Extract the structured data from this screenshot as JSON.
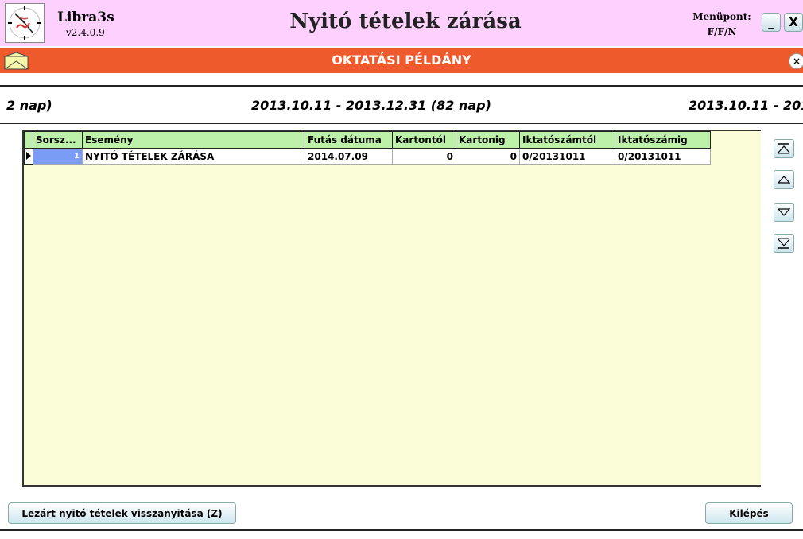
{
  "app": {
    "name": "Libra3s",
    "version": "v2.4.0.9",
    "window_title": "Nyitó tételek zárása",
    "menu_label": "Menüpont:",
    "menu_code": "F/F/N",
    "minimize_label": "_",
    "close_label": "X"
  },
  "banner": {
    "text": "OKTATÁSI PÉLDÁNY",
    "close_label": "×",
    "color": "#ee5a2c"
  },
  "periods": {
    "left": "2 nap)",
    "center": "2013.10.11 - 2013.12.31 (82 nap)",
    "right": "2013.10.11 - 201"
  },
  "grid": {
    "columns": [
      "Sorsz...",
      "Esemény",
      "Futás dátuma",
      "Kartontól",
      "Kartonig",
      "Iktatószámtól",
      "Iktatószámig"
    ],
    "rows": [
      {
        "sorsz": "1",
        "esemeny": "NYITÓ TÉTELEK ZÁRÁSA",
        "datum": "2014.07.09",
        "kartontol": "0",
        "kartonig": "0",
        "iktatoszamtol": "0/20131011",
        "iktatoszamig": "0/20131011"
      }
    ]
  },
  "nav": {
    "first_icon": "first-record-icon",
    "prev_icon": "previous-record-icon",
    "next_icon": "next-record-icon",
    "last_icon": "last-record-icon"
  },
  "actions": {
    "restore_label": "Lezárt nyitó tételek visszanyitása (Z)",
    "exit_label": "Kilépés"
  }
}
